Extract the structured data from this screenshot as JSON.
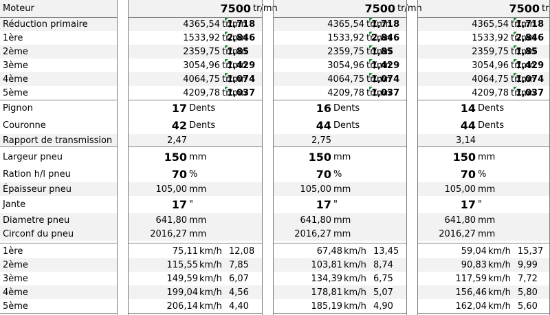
{
  "moteur": {
    "label": "Moteur",
    "cols": [
      {
        "value": "7500",
        "unit": "tr/mn"
      },
      {
        "value": "7500",
        "unit": "tr/mn"
      },
      {
        "value": "7500",
        "unit": "tr/mn"
      }
    ]
  },
  "speed_rows": [
    {
      "label": "Réduction primaire",
      "cols": [
        {
          "value": "4365,54",
          "unit": "tr/mn",
          "ratio": "1,718"
        },
        {
          "value": "4365,54",
          "unit": "tr/mn",
          "ratio": "1,718"
        },
        {
          "value": "4365,54",
          "unit": "tr/mn",
          "ratio": "1,718"
        }
      ]
    },
    {
      "label": "1ère",
      "cols": [
        {
          "value": "1533,92",
          "unit": "tr/mn",
          "ratio": "2,846"
        },
        {
          "value": "1533,92",
          "unit": "tr/mn",
          "ratio": "2,846"
        },
        {
          "value": "1533,92",
          "unit": "tr/mn",
          "ratio": "2,846"
        }
      ]
    },
    {
      "label": "2ème",
      "cols": [
        {
          "value": "2359,75",
          "unit": "tr/mn",
          "ratio": "1,85"
        },
        {
          "value": "2359,75",
          "unit": "tr/mn",
          "ratio": "1,85"
        },
        {
          "value": "2359,75",
          "unit": "tr/mn",
          "ratio": "1,85"
        }
      ]
    },
    {
      "label": "3ème",
      "cols": [
        {
          "value": "3054,96",
          "unit": "tr/mn",
          "ratio": "1,429"
        },
        {
          "value": "3054,96",
          "unit": "tr/mn",
          "ratio": "1,429"
        },
        {
          "value": "3054,96",
          "unit": "tr/mn",
          "ratio": "1,429"
        }
      ]
    },
    {
      "label": "4ème",
      "cols": [
        {
          "value": "4064,75",
          "unit": "tr/mn",
          "ratio": "1,074"
        },
        {
          "value": "4064,75",
          "unit": "tr/mn",
          "ratio": "1,074"
        },
        {
          "value": "4064,75",
          "unit": "tr/mn",
          "ratio": "1,074"
        }
      ]
    },
    {
      "label": "5ème",
      "cols": [
        {
          "value": "4209,78",
          "unit": "tr/mn",
          "ratio": "1,037"
        },
        {
          "value": "4209,78",
          "unit": "tr/mn",
          "ratio": "1,037"
        },
        {
          "value": "4209,78",
          "unit": "tr/mn",
          "ratio": "1,037"
        }
      ]
    }
  ],
  "pignon": {
    "label": "Pignon",
    "cols": [
      {
        "value": "17",
        "unit": "Dents"
      },
      {
        "value": "16",
        "unit": "Dents"
      },
      {
        "value": "14",
        "unit": "Dents"
      }
    ]
  },
  "couronne": {
    "label": "Couronne",
    "cols": [
      {
        "value": "42",
        "unit": "Dents"
      },
      {
        "value": "44",
        "unit": "Dents"
      },
      {
        "value": "44",
        "unit": "Dents"
      }
    ]
  },
  "rapport": {
    "label": "Rapport de transmission",
    "cols": [
      "2,47",
      "2,75",
      "3,14"
    ]
  },
  "largeur": {
    "label": "Largeur pneu",
    "cols": [
      {
        "value": "150",
        "unit": "mm"
      },
      {
        "value": "150",
        "unit": "mm"
      },
      {
        "value": "150",
        "unit": "mm"
      }
    ]
  },
  "ration": {
    "label": "Ration h/l pneu",
    "cols": [
      {
        "value": "70",
        "unit": "%"
      },
      {
        "value": "70",
        "unit": "%"
      },
      {
        "value": "70",
        "unit": "%"
      }
    ]
  },
  "epaisseur": {
    "label": "Épaisseur pneu",
    "cols": [
      {
        "value": "105,00",
        "unit": "mm"
      },
      {
        "value": "105,00",
        "unit": "mm"
      },
      {
        "value": "105,00",
        "unit": "mm"
      }
    ]
  },
  "jante": {
    "label": "Jante",
    "cols": [
      {
        "value": "17",
        "unit": "\""
      },
      {
        "value": "17",
        "unit": "\""
      },
      {
        "value": "17",
        "unit": "\""
      }
    ]
  },
  "diametre": {
    "label": "Diametre pneu",
    "cols": [
      {
        "value": "641,80",
        "unit": "mm"
      },
      {
        "value": "641,80",
        "unit": "mm"
      },
      {
        "value": "641,80",
        "unit": "mm"
      }
    ]
  },
  "circonf": {
    "label": "Circonf du pneu",
    "cols": [
      {
        "value": "2016,27",
        "unit": "mm"
      },
      {
        "value": "2016,27",
        "unit": "mm"
      },
      {
        "value": "2016,27",
        "unit": "mm"
      }
    ]
  },
  "kmh_rows": [
    {
      "label": "1ère",
      "cols": [
        {
          "value": "75,11",
          "unit": "km/h",
          "extra": "12,08"
        },
        {
          "value": "67,48",
          "unit": "km/h",
          "extra": "13,45"
        },
        {
          "value": "59,04",
          "unit": "km/h",
          "extra": "15,37"
        }
      ]
    },
    {
      "label": "2ème",
      "cols": [
        {
          "value": "115,55",
          "unit": "km/h",
          "extra": "7,85"
        },
        {
          "value": "103,81",
          "unit": "km/h",
          "extra": "8,74"
        },
        {
          "value": "90,83",
          "unit": "km/h",
          "extra": "9,99"
        }
      ]
    },
    {
      "label": "3ème",
      "cols": [
        {
          "value": "149,59",
          "unit": "km/h",
          "extra": "6,07"
        },
        {
          "value": "134,39",
          "unit": "km/h",
          "extra": "6,75"
        },
        {
          "value": "117,59",
          "unit": "km/h",
          "extra": "7,72"
        }
      ]
    },
    {
      "label": "4ème",
      "cols": [
        {
          "value": "199,04",
          "unit": "km/h",
          "extra": "4,56"
        },
        {
          "value": "178,81",
          "unit": "km/h",
          "extra": "5,07"
        },
        {
          "value": "156,46",
          "unit": "km/h",
          "extra": "5,80"
        }
      ]
    },
    {
      "label": "5ème",
      "cols": [
        {
          "value": "206,14",
          "unit": "km/h",
          "extra": "4,40"
        },
        {
          "value": "185,19",
          "unit": "km/h",
          "extra": "4,90"
        },
        {
          "value": "162,04",
          "unit": "km/h",
          "extra": "5,60"
        }
      ]
    }
  ],
  "colors": {
    "grid": "#7f7f7f",
    "shade": "#f2f2f2",
    "marker": "#1e8a3c"
  }
}
